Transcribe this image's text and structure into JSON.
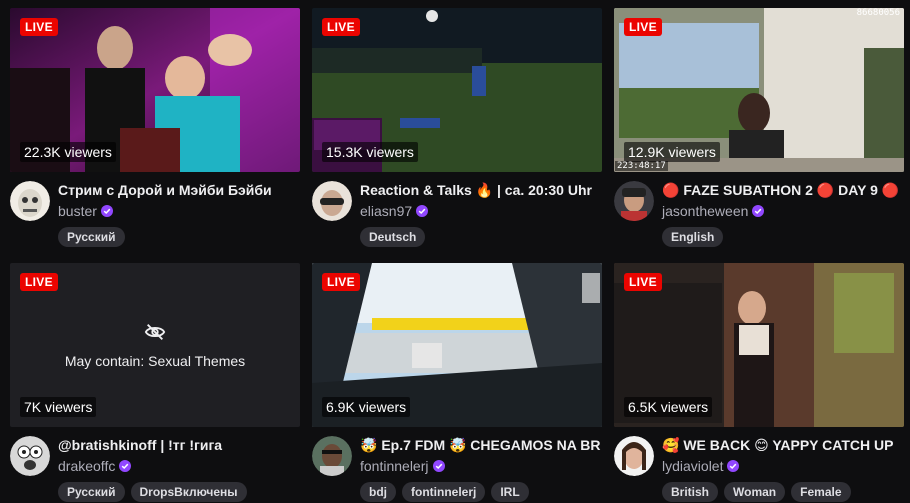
{
  "live_label": "LIVE",
  "corner_readout": "86680056",
  "cards": [
    {
      "viewers": "22.3K viewers",
      "title": "Стрим с Дорой и Мэйби Бэйби",
      "channel": "buster",
      "tags": [
        "Русский"
      ]
    },
    {
      "viewers": "15.3K viewers",
      "title": "Reaction & Talks 🔥 | ca. 20:30 Uhr",
      "channel": "eliasn97",
      "tags": [
        "Deutsch"
      ]
    },
    {
      "viewers": "12.9K viewers",
      "timestamp": "223:48:17",
      "title": "🔴 FAZE SUBATHON 2 🔴 DAY 9 🔴",
      "channel": "jasontheween",
      "tags": [
        "English"
      ]
    },
    {
      "viewers": "7K viewers",
      "warning": "May contain: Sexual Themes",
      "title": "@bratishkinoff | !тг !гига",
      "channel": "drakeoffc",
      "tags": [
        "Русский",
        "DropsВключены"
      ]
    },
    {
      "viewers": "6.9K viewers",
      "title": "🤯 Ep.7 FDM 🤯 CHEGAMOS NA BR",
      "channel": "fontinnelerj",
      "tags": [
        "bdj",
        "fontinnelerj",
        "IRL"
      ]
    },
    {
      "viewers": "6.5K viewers",
      "title": "🥰 WE BACK 😊 YAPPY CATCH UP",
      "channel": "lydiaviolet",
      "tags": [
        "British",
        "Woman",
        "Female"
      ]
    }
  ],
  "colors": {
    "background": "#0e0e10",
    "live_red": "#eb0400",
    "verified_purple": "#9147ff",
    "tag_bg": "#2f2f35"
  }
}
